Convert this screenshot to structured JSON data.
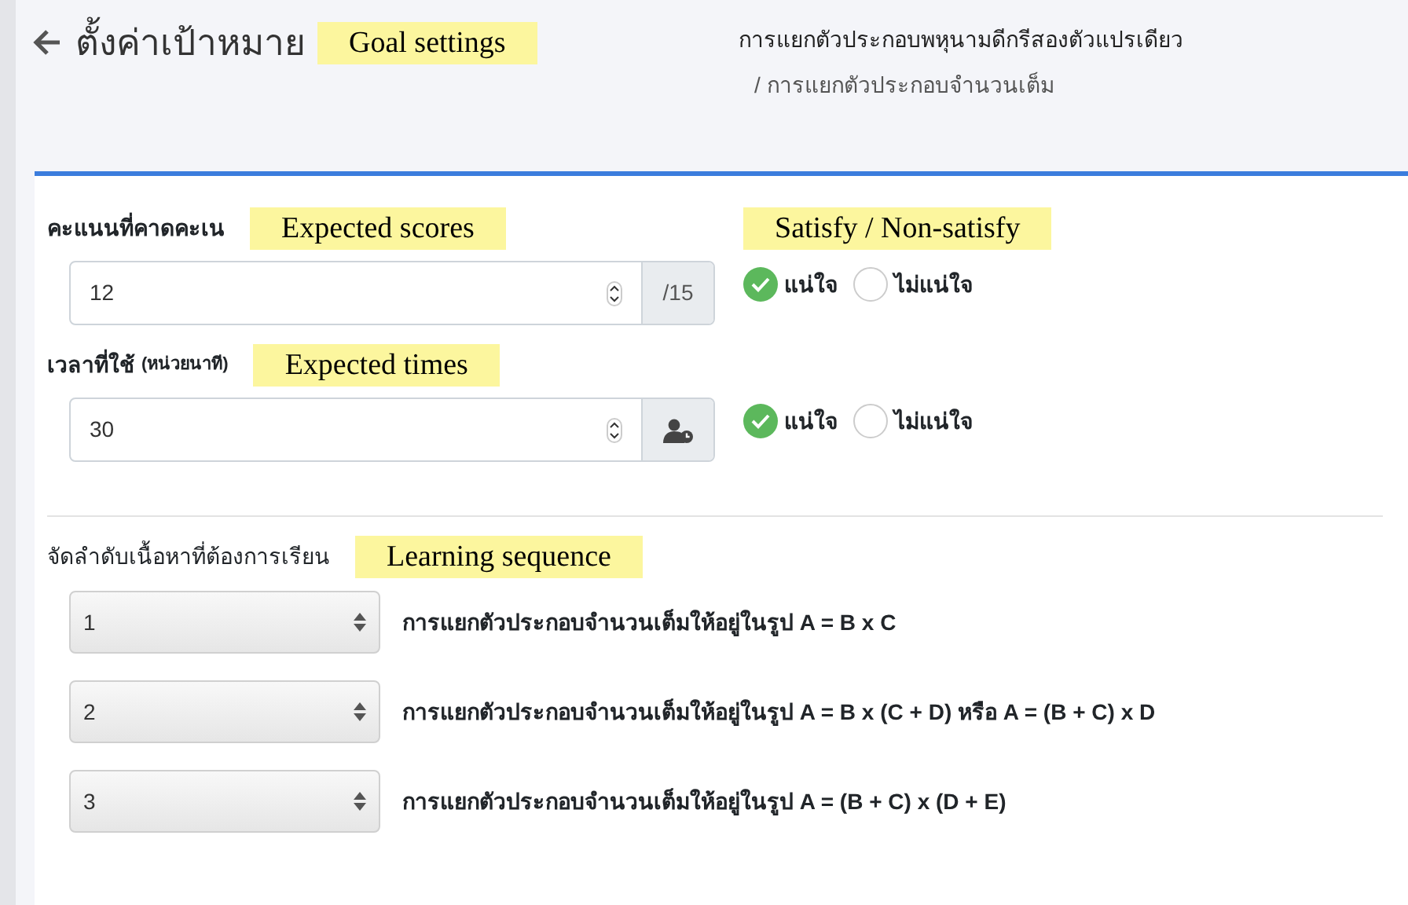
{
  "header": {
    "title": "ตั้งค่าเป้าหมาย",
    "annotation": "Goal settings",
    "breadcrumb": [
      "การแยกตัวประกอบพหุนามดีกรีสองตัวแปรเดียว",
      "/ การแยกตัวประกอบจำนวนเต็ม"
    ]
  },
  "goals": [
    {
      "label": "คะแนนที่คาดคะเน",
      "annotation": "Expected scores",
      "value": "12",
      "addon": {
        "kind": "text",
        "text": "/15"
      },
      "options": [
        {
          "label": "แน่ใจ",
          "selected": true
        },
        {
          "label": "ไม่แน่ใจ",
          "selected": false
        }
      ],
      "options_annotation": "Satisfy / Non-satisfy"
    },
    {
      "label": "เวลาที่ใช้",
      "hint": "(หน่วยนาที)",
      "annotation": "Expected times",
      "value": "30",
      "addon": {
        "kind": "icon"
      },
      "options": [
        {
          "label": "แน่ใจ",
          "selected": true
        },
        {
          "label": "ไม่แน่ใจ",
          "selected": false
        }
      ]
    }
  ],
  "sequence": {
    "label": "จัดลำดับเนื้อหาที่ต้องการเรียน",
    "annotation": "Learning sequence",
    "items": [
      {
        "order": "1",
        "text": "การแยกตัวประกอบจำนวนเต็มให้อยู่ในรูป A = B x C"
      },
      {
        "order": "2",
        "text": "การแยกตัวประกอบจำนวนเต็มให้อยู่ในรูป A = B x (C + D) หรือ A = (B + C) x D"
      },
      {
        "order": "3",
        "text": "การแยกตัวประกอบจำนวนเต็มให้อยู่ในรูป A = (B + C) x (D + E)"
      }
    ]
  }
}
